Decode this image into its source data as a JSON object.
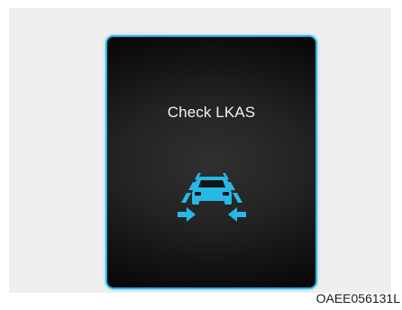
{
  "cluster_display": {
    "message": "Check LKAS",
    "icon": "lkas-warning-icon",
    "icon_color": "#27b8e4",
    "screen_border_color": "#27b8e4"
  },
  "figure_code": "OAEE056131L"
}
